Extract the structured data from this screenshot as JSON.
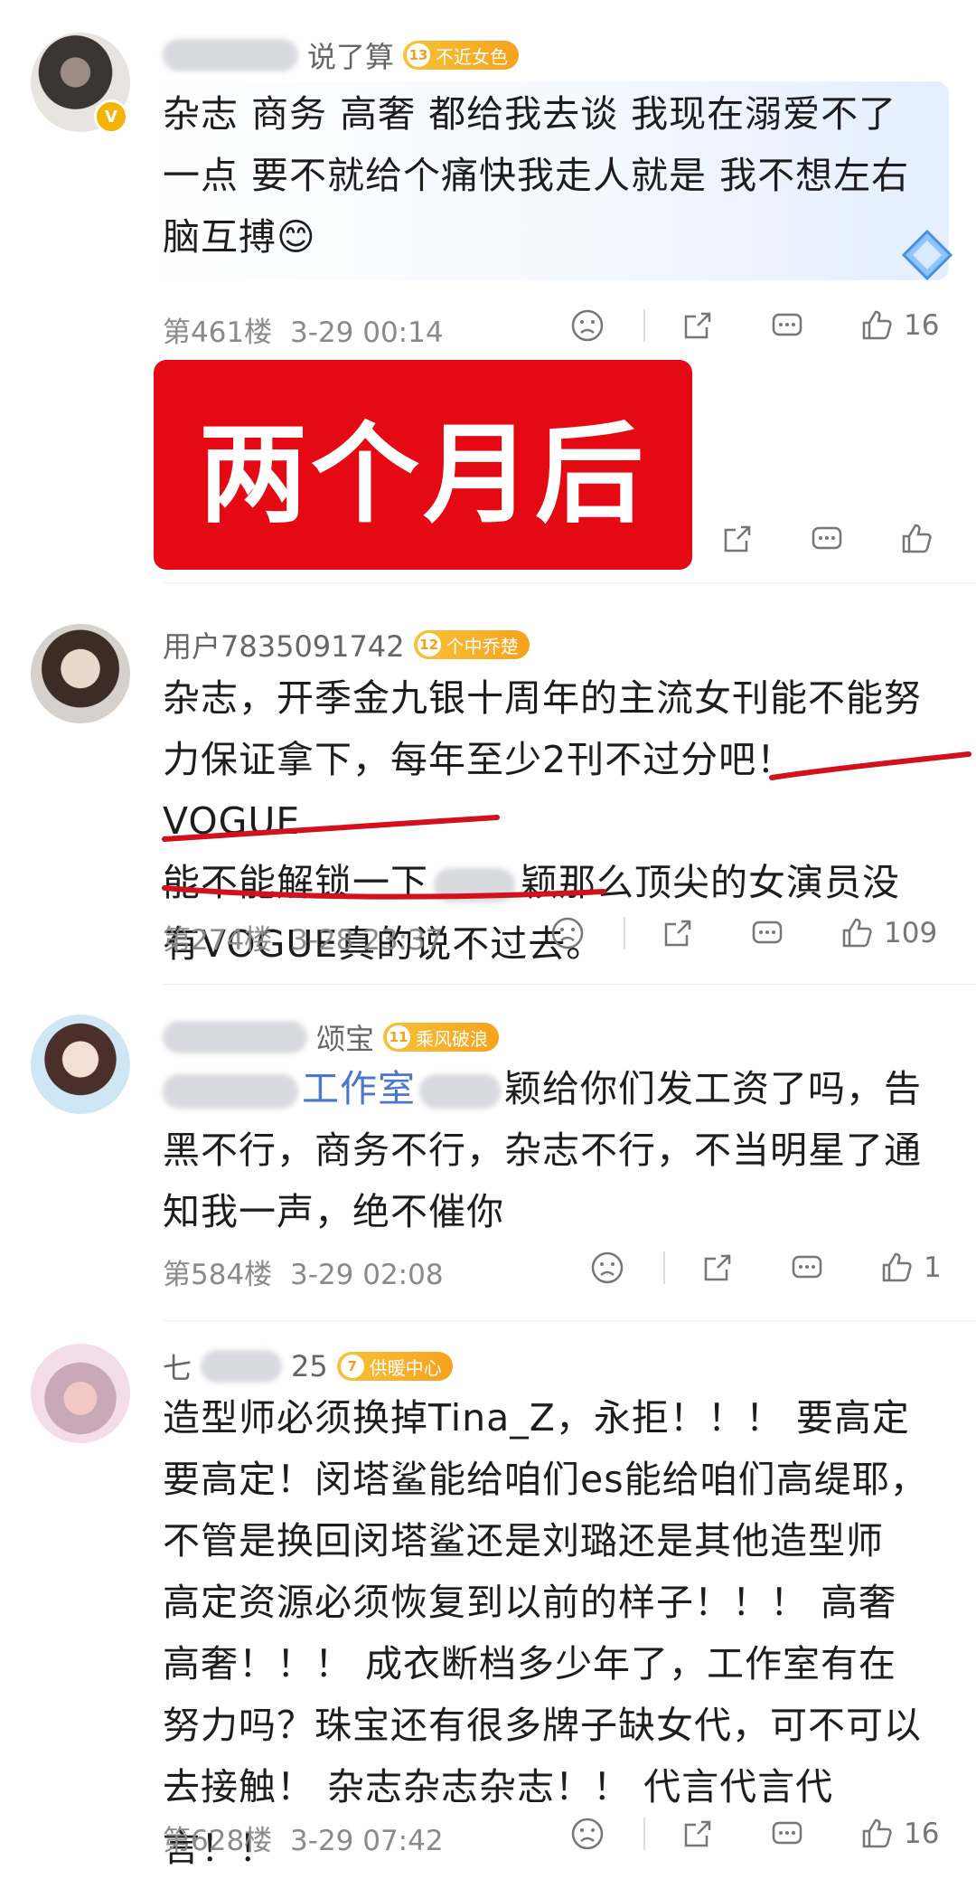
{
  "comments": [
    {
      "name_visible": "说了算",
      "fan": {
        "level": "13",
        "label": "不近女色"
      },
      "text": "杂志 商务 高奢 都给我去谈 我现在溺爱不了一点 要不就给个痛快我走人就是 我不想左右脑互搏😊",
      "floor": "第461楼",
      "time": "3-29 00:14",
      "likes": "16"
    },
    {
      "name_visible": "用户7835091742",
      "fan": {
        "level": "12",
        "label": "个中乔楚"
      },
      "text_parts": {
        "line1": "杂志，开季金九银十周年的主流女刊能不能努",
        "line2": "力保证拿下，每年至少2刊不过分吧！VOGUE",
        "line3a": "能不能解锁一下",
        "line3b": "颖那么顶尖的女演员没",
        "line4": "有VOGUE真的说不过去。"
      },
      "floor": "第274楼",
      "time": "3-28 23:37",
      "likes": "109"
    },
    {
      "name_visible": "颂宝",
      "fan": {
        "level": "11",
        "label": "乘风破浪"
      },
      "text_parts": {
        "studio": "工作室",
        "line1": "颖给你们发工资了吗，告",
        "line2": "黑不行，商务不行，杂志不行，不当明星了通",
        "line3": "知我一声，绝不催你"
      },
      "floor": "第584楼",
      "time": "3-29 02:08",
      "likes": "1"
    },
    {
      "name_visible_start": "七",
      "name_visible_end": "25",
      "fan": {
        "level": "7",
        "label": "供暖中心"
      },
      "text": "造型师必须换掉Tina_Z，永拒！！！ 要高定要高定！闵塔鲨能给咱们es能给咱们高缇耶，不管是换回闵塔鲨还是刘璐还是其他造型师 高定资源必须恢复到以前的样子！！！ 高奢高奢！！！ 成衣断档多少年了，工作室有在努力吗？珠宝还有很多牌子缺女代，可不可以去接触！ 杂志杂志杂志！！ 代言代言代言！！",
      "floor": "第628楼",
      "time": "3-29 07:42",
      "likes": "16"
    }
  ],
  "banner": {
    "text": "两个月后"
  },
  "colors": {
    "banner_red": "#e50914",
    "fan_badge": "#f6a21c",
    "underline_red": "#d3111c"
  }
}
